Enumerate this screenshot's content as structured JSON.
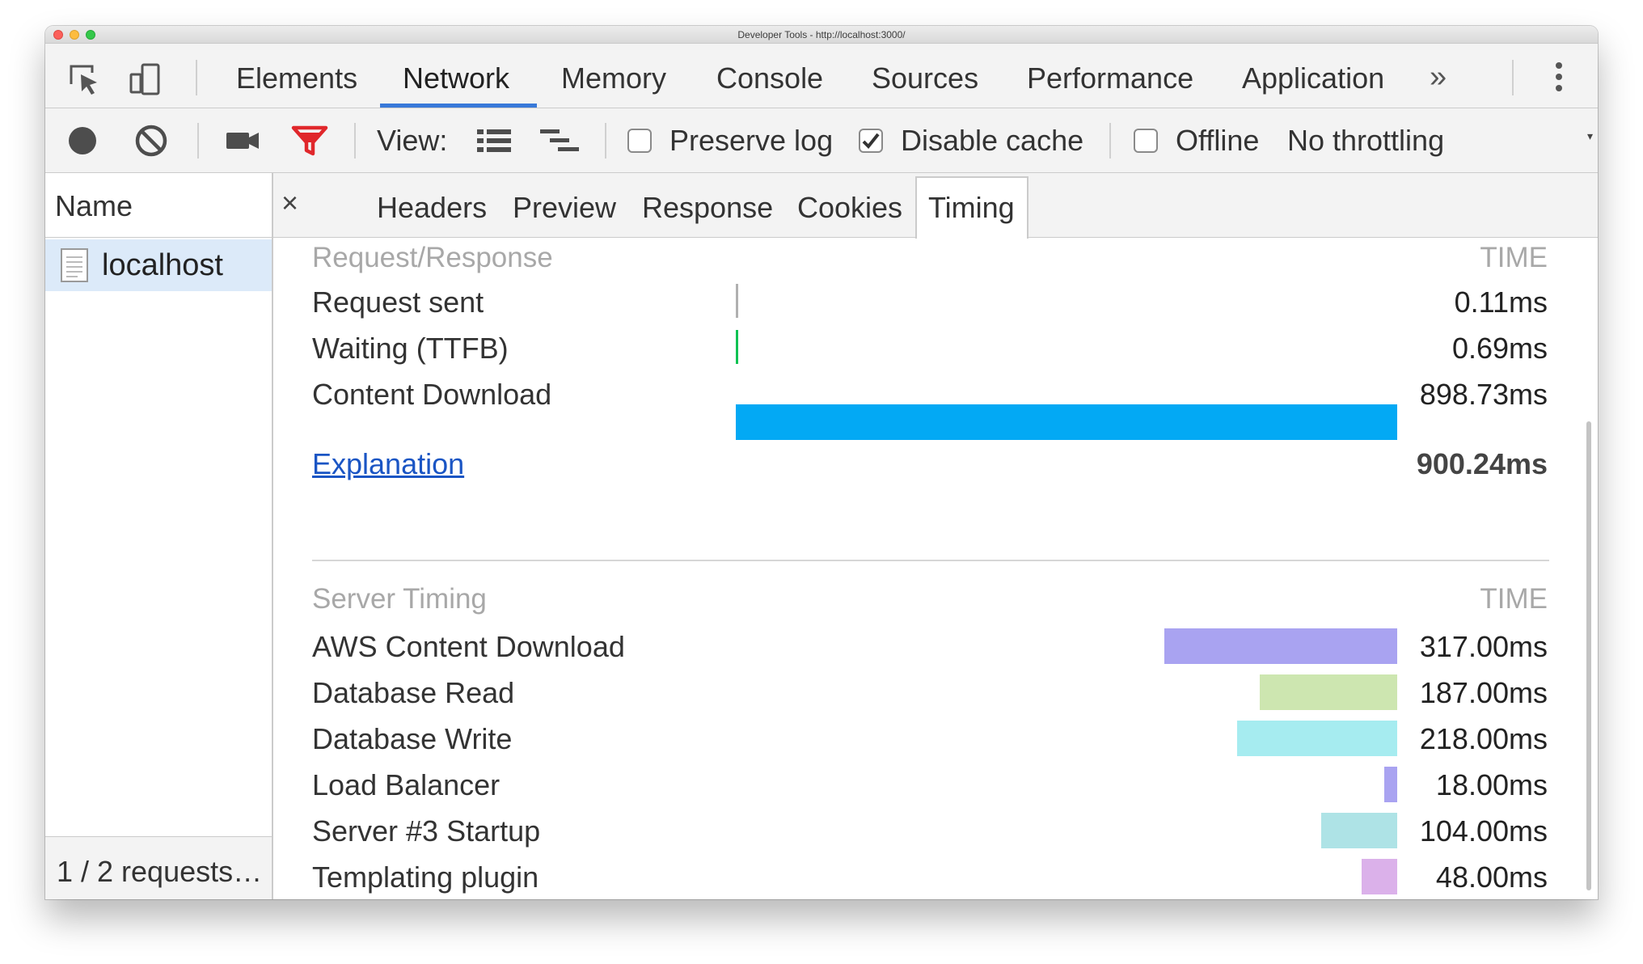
{
  "window": {
    "title": "Developer Tools - http://localhost:3000/"
  },
  "main_tabs": {
    "items": [
      "Elements",
      "Network",
      "Memory",
      "Console",
      "Sources",
      "Performance",
      "Application"
    ],
    "active": "Network",
    "more": "»"
  },
  "toolbar": {
    "view_label": "View:",
    "preserve_log": {
      "label": "Preserve log",
      "checked": false
    },
    "disable_cache": {
      "label": "Disable cache",
      "checked": true
    },
    "offline": {
      "label": "Offline",
      "checked": false
    },
    "throttling": "No throttling",
    "filter_color": "#e0272b",
    "accent": "#3879d9"
  },
  "requests_panel": {
    "header": "Name",
    "items": [
      {
        "name": "localhost"
      }
    ],
    "footer": "1 / 2 requests…"
  },
  "detail_tabs": {
    "close": "×",
    "items": [
      "Headers",
      "Preview",
      "Response",
      "Cookies",
      "Timing"
    ],
    "active": "Timing"
  },
  "timing": {
    "request_response": {
      "title": "Request/Response",
      "time_header": "TIME",
      "rows": [
        {
          "label": "Request sent",
          "value": "0.11ms",
          "color": "#b0b0b0"
        },
        {
          "label": "Waiting (TTFB)",
          "value": "0.69ms",
          "color": "#10c253"
        },
        {
          "label": "Content Download",
          "value": "898.73ms",
          "color": "#03a9f4"
        }
      ],
      "explanation_link": "Explanation",
      "total": "900.24ms"
    },
    "server_timing": {
      "title": "Server Timing",
      "time_header": "TIME",
      "rows": [
        {
          "label": "AWS Content Download",
          "value": "317.00ms",
          "color": "#a9a3f1"
        },
        {
          "label": "Database Read",
          "value": "187.00ms",
          "color": "#cde6b0"
        },
        {
          "label": "Database Write",
          "value": "218.00ms",
          "color": "#a6ecf0"
        },
        {
          "label": "Load Balancer",
          "value": "18.00ms",
          "color": "#a9a3f1"
        },
        {
          "label": "Server #3 Startup",
          "value": "104.00ms",
          "color": "#aee3e6"
        },
        {
          "label": "Templating plugin",
          "value": "48.00ms",
          "color": "#dbb1ea"
        }
      ]
    }
  }
}
